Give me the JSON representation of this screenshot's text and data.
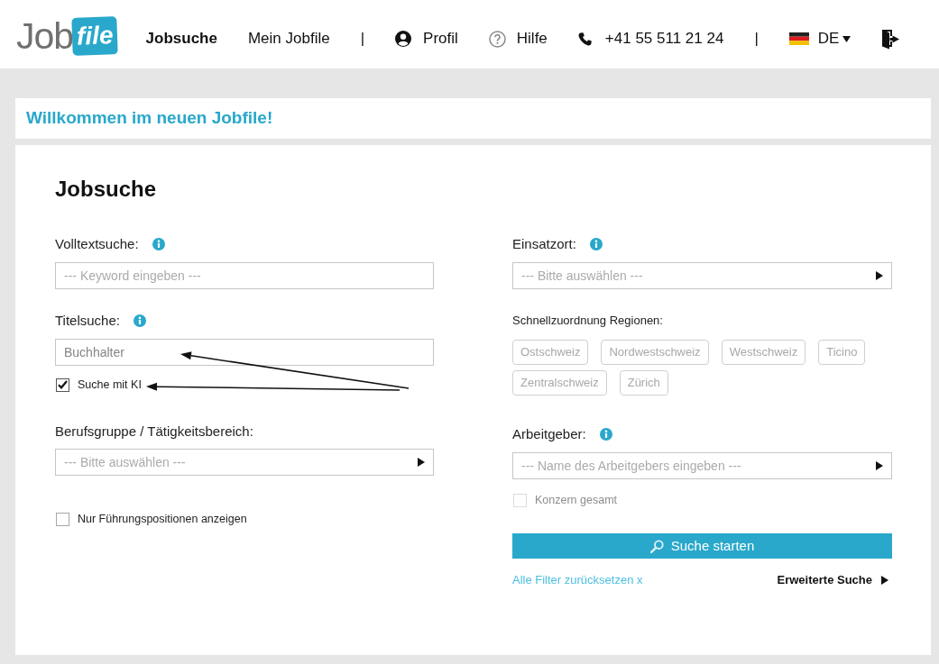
{
  "header": {
    "logo": {
      "wordmark": "Job",
      "badge": "file"
    },
    "nav": [
      {
        "label": "Jobsuche",
        "selected": true
      },
      {
        "label": "Mein Jobfile",
        "selected": false
      }
    ],
    "divider_1": "|",
    "profile": "Profil",
    "help": "Hilfe",
    "phone": "+41 55 511 21 24",
    "divider_2": "|",
    "language": "DE"
  },
  "welcome": "Willkommen im neuen Jobfile!",
  "search": {
    "title": "Jobsuche",
    "fulltext": {
      "label": "Volltextsuche:",
      "info": true,
      "kind": "input",
      "placeholder": "--- Keyword eingeben ---"
    },
    "title_search": {
      "label": "Titelsuche:",
      "info": true,
      "kind": "input",
      "value": "Buchhalter"
    },
    "ai_search": {
      "label": "Suche mit KI",
      "checked": true
    },
    "occupation": {
      "label": "Berufsgruppe / Tätigkeitsbereich:",
      "info": false,
      "kind": "select",
      "placeholder": "--- Bitte auswählen ---"
    },
    "leadership_only": {
      "label": "Nur Führungspositionen anzeigen",
      "checked": false
    },
    "location": {
      "label": "Einsatzort:",
      "info": true,
      "kind": "select",
      "placeholder": "--- Bitte auswählen ---"
    },
    "regions": {
      "label": "Schnellzuordnung Regionen:",
      "items": [
        {
          "label": "Ostschweiz",
          "selected": false
        },
        {
          "label": "Nordwestschweiz",
          "selected": false
        },
        {
          "label": "Westschweiz",
          "selected": false
        },
        {
          "label": "Ticino",
          "selected": false
        },
        {
          "label": "Zentralschweiz",
          "selected": false
        },
        {
          "label": "Zürich",
          "selected": false
        }
      ]
    },
    "employer": {
      "label": "Arbeitgeber:",
      "info": true,
      "kind": "select",
      "placeholder": "--- Name des Arbeitgebers eingeben ---"
    },
    "group_total": {
      "label": "Konzern gesamt",
      "checked": false,
      "disabled": true
    },
    "submit": "Suche starten",
    "reset_link": "Alle Filter zurücksetzen x",
    "advanced_link": "Erweiterte Suche"
  }
}
